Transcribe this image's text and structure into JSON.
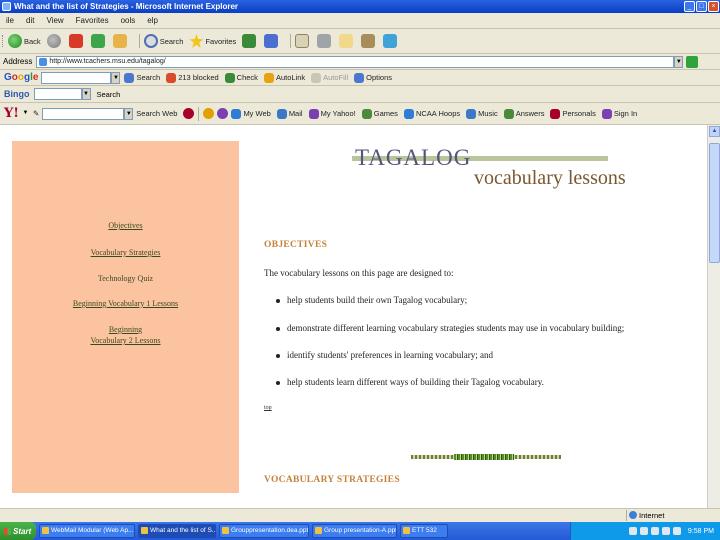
{
  "window": {
    "title": "What and the list of Strategies - Microsoft Internet Explorer",
    "buttons": {
      "minimize": "_",
      "maximize": "□",
      "close": "×"
    }
  },
  "menu": [
    "ile",
    "dit",
    "View",
    "Favorites",
    "ools",
    "elp"
  ],
  "standard_toolbar": {
    "back": "Back",
    "search": "Search",
    "favorites": "Favorites"
  },
  "address_bar": {
    "label": "Address",
    "url": "http://www.tcachers.msu.edu/tagalog/"
  },
  "google_toolbar": {
    "search": "Search",
    "blocked": "213 blocked",
    "check": "Check",
    "autolink": "AutoLink",
    "autofill": "AutoFill",
    "options": "Options"
  },
  "bingo_toolbar": {
    "logo": "Bingo",
    "search": "Search"
  },
  "yahoo_toolbar": {
    "logo": "Y!",
    "search_web": "Search Web",
    "my_web": "My Web",
    "mail": "Mail",
    "my_yahoo": "My Yahoo!",
    "games": "Games",
    "ncaa": "NCAA Hoops",
    "music": "Music",
    "answers": "Answers",
    "personals": "Personals",
    "sign_in": "Sign In"
  },
  "page": {
    "logo_title": "TAGALOG",
    "logo_subtitle": "vocabulary lessons",
    "sidebar_links": [
      "Objectives",
      "Vocabulary Strategies",
      "Technology Quiz",
      "Beginning Vocabulary 1 Lessons",
      "Beginning",
      "Vocabulary 2 Lessons"
    ],
    "objectives_heading": "OBJECTIVES",
    "intro": "The vocabulary lessons on this page are designed to:",
    "bullets": [
      "help students build their own Tagalog vocabulary;",
      "demonstrate different learning vocabulary strategies students may use in vocabulary building;",
      "identify students' preferences in learning vocabulary; and",
      "help students learn different ways of building their Tagalog vocabulary."
    ],
    "top_link": "top",
    "strategies_heading": "VOCABULARY STRATEGIES"
  },
  "status_bar": {
    "zone": "Internet"
  },
  "taskbar": {
    "start": "Start",
    "tasks": [
      "WebMail Modular (Web Ap...",
      "What and the list of S...",
      "Grouppresentation.dea.ppt",
      "Group presentation-A.ppt",
      "ETT 532"
    ],
    "clock": "9:58 PM"
  }
}
